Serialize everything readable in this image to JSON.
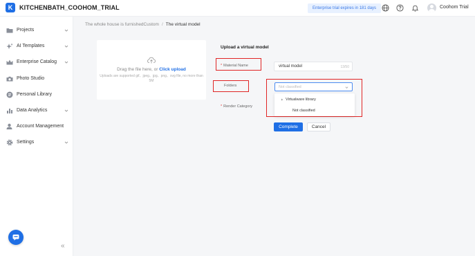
{
  "app": {
    "logo_letter": "K",
    "name": "KITCHENBATH_COOHOM_TRIAL",
    "expiry_notice": "Enterprise trial expires in 181 days",
    "user_name": "Coohom Trial",
    "accent_color": "#1f6fe5"
  },
  "sidebar": {
    "items": [
      {
        "label": "Projects",
        "icon": "folder-icon",
        "has_chevron": true
      },
      {
        "label": "AI Templates",
        "icon": "ai-sparkle-icon",
        "has_chevron": true
      },
      {
        "label": "Enterprise Catalog",
        "icon": "catalog-icon",
        "has_chevron": true
      },
      {
        "label": "Photo Studio",
        "icon": "camera-icon",
        "has_chevron": false
      },
      {
        "label": "Personal Library",
        "icon": "library-icon",
        "has_chevron": false
      },
      {
        "label": "Data Analytics",
        "icon": "chart-icon",
        "has_chevron": true
      },
      {
        "label": "Account Management",
        "icon": "account-icon",
        "has_chevron": false
      },
      {
        "label": "Settings",
        "icon": "gear-icon",
        "has_chevron": true
      }
    ],
    "collapse_glyph": "«"
  },
  "breadcrumb": {
    "parent": "The whole house is furnishedCustom",
    "separator": "/",
    "current": "The virtual model"
  },
  "upload": {
    "prompt_prefix": "Drag the file here, or ",
    "prompt_link": "Click upload",
    "hint": "Uploads are supported gif、jpeg、jpg、png、svg file, no more than 5M"
  },
  "form": {
    "title": "Upload a virtual model",
    "required_mark": "*",
    "material_name_label": "Material Name",
    "material_name_value": "virtual model",
    "material_name_count": "13/50",
    "folders_label": "Folders",
    "folders_placeholder": "Not classified",
    "render_category_label": "Render Category",
    "dropdown_options": [
      {
        "label": "Virtualware library",
        "expandable": true
      },
      {
        "label": "Not classified",
        "expandable": false
      }
    ],
    "complete_label": "Complete",
    "cancel_label": "Cancel"
  },
  "highlight_color": "#e02424"
}
